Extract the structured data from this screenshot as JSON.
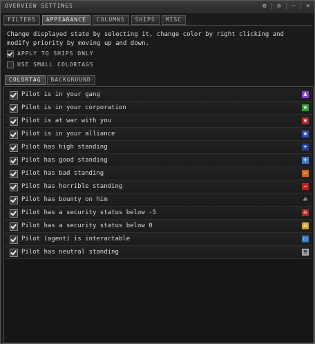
{
  "window": {
    "title": "OVERVIEW SETTINGS",
    "buttons": [
      "⚙",
      "◎",
      "–",
      "×"
    ]
  },
  "tabs": [
    {
      "label": "FILTERS",
      "active": false
    },
    {
      "label": "APPEARANCE",
      "active": true
    },
    {
      "label": "COLUMNS",
      "active": false
    },
    {
      "label": "SHIPS",
      "active": false
    },
    {
      "label": "MISC",
      "active": false
    }
  ],
  "appearance": {
    "description": "Change displayed state by selecting it, change color by right clicking and modify priority by moving up and down.",
    "apply_to_ships_only": {
      "label": "APPLY TO SHIPS ONLY",
      "checked": true
    },
    "use_small_colortags": {
      "label": "USE SMALL COLORTAGS",
      "checked": false
    }
  },
  "subtabs": [
    {
      "label": "COLORTAG",
      "active": true
    },
    {
      "label": "BACKGROUND",
      "active": false
    }
  ],
  "states": [
    {
      "label": "Pilot is in your gang",
      "checked": true,
      "tag_icon": "gang-icon",
      "tag_glyph": "♟",
      "tag_color": "#8a3fd1"
    },
    {
      "label": "Pilot is in your corporation",
      "checked": true,
      "tag_icon": "star-icon",
      "tag_glyph": "★",
      "tag_color": "#2e9a34"
    },
    {
      "label": "Pilot is at war with you",
      "checked": true,
      "tag_icon": "star-icon",
      "tag_glyph": "★",
      "tag_color": "#b8242a"
    },
    {
      "label": "Pilot is in your alliance",
      "checked": true,
      "tag_icon": "star-icon",
      "tag_glyph": "★",
      "tag_color": "#2a4fb8"
    },
    {
      "label": "Pilot has high standing",
      "checked": true,
      "tag_icon": "plus-icon",
      "tag_glyph": "+",
      "tag_color": "#1e3f9e"
    },
    {
      "label": "Pilot has good standing",
      "checked": true,
      "tag_icon": "plus-icon",
      "tag_glyph": "+",
      "tag_color": "#3f7ad6"
    },
    {
      "label": "Pilot has bad standing",
      "checked": true,
      "tag_icon": "minus-icon",
      "tag_glyph": "−",
      "tag_color": "#d9651b"
    },
    {
      "label": "Pilot has horrible standing",
      "checked": true,
      "tag_icon": "minus-icon",
      "tag_glyph": "−",
      "tag_color": "#c01e1e"
    },
    {
      "label": "Pilot has bounty on him",
      "checked": true,
      "tag_icon": "skull-icon",
      "tag_glyph": "☠",
      "tag_color": "#1a1a1a"
    },
    {
      "label": "Pilot has a security status below -5",
      "checked": true,
      "tag_icon": "skull-icon",
      "tag_glyph": "☠",
      "tag_color": "#b02020"
    },
    {
      "label": "Pilot has a security status below 0",
      "checked": true,
      "tag_icon": "skull-icon",
      "tag_glyph": "☠",
      "tag_color": "#d9a21b"
    },
    {
      "label": "Pilot (agent) is interactable",
      "checked": true,
      "tag_icon": "speech-bubble-icon",
      "tag_glyph": "▭",
      "tag_color": "#2f74c8"
    },
    {
      "label": "Pilot has neutral standing",
      "checked": true,
      "tag_icon": "equals-icon",
      "tag_glyph": "≡",
      "tag_color": "#a8a8a8"
    }
  ]
}
